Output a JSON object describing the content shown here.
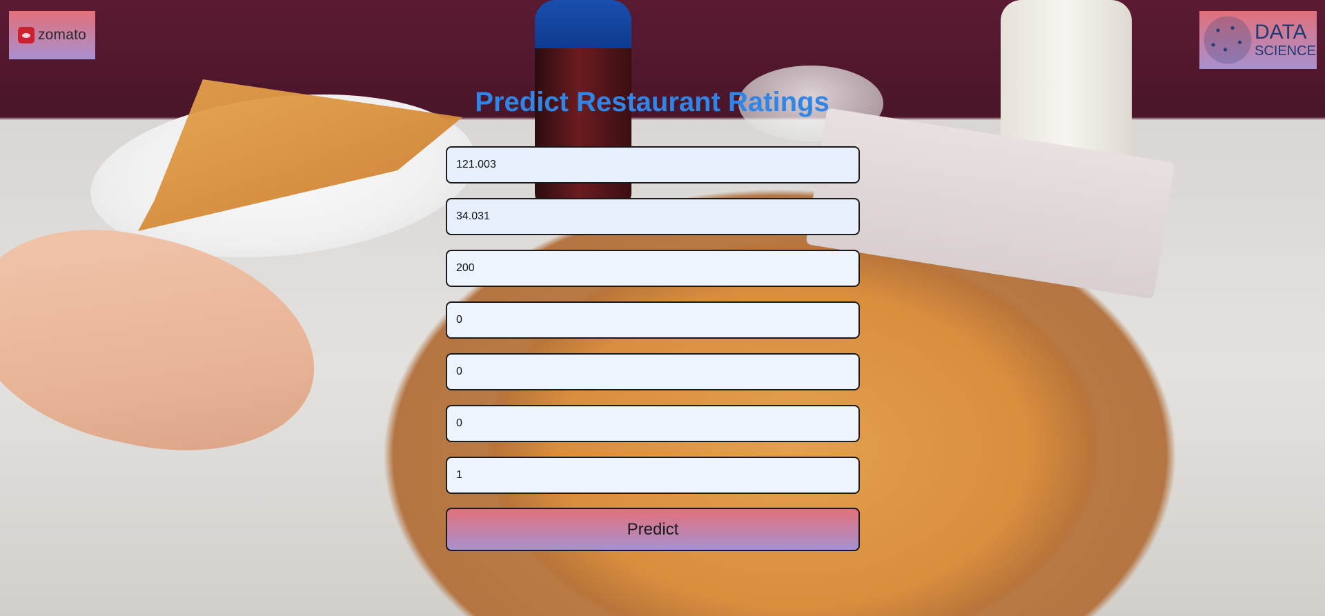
{
  "header": {
    "zomato_logo_text": "zomato",
    "data_science_logo": {
      "line1": "DATA",
      "line2": "SCIENCE"
    }
  },
  "main": {
    "title": "Predict Restaurant Ratings",
    "fields": [
      {
        "value": "121.003"
      },
      {
        "value": "34.031"
      },
      {
        "value": "200"
      },
      {
        "value": "0"
      },
      {
        "value": "0"
      },
      {
        "value": "0"
      },
      {
        "value": "1"
      }
    ],
    "predict_label": "Predict"
  },
  "colors": {
    "title": "#2f86e8",
    "button_gradient_top": "#e2707a",
    "button_gradient_bottom": "#a891d0",
    "input_background": "#eef4fd"
  }
}
